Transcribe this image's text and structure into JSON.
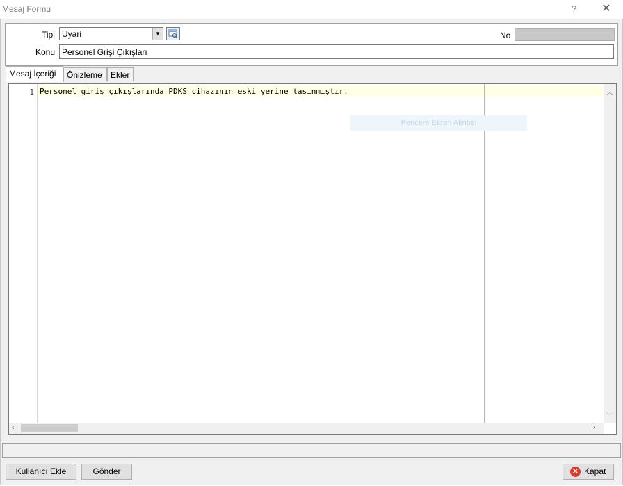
{
  "window": {
    "title": "Mesaj Formu",
    "help_glyph": "?",
    "close_glyph": "✕"
  },
  "form": {
    "type_label": "Tipi",
    "type_value": "Uyari",
    "no_label": "No",
    "no_value": "",
    "subject_label": "Konu",
    "subject_value": "Personel Grişi Çıkışları"
  },
  "tabs": [
    {
      "label": "Mesaj İçeriği",
      "active": true
    },
    {
      "label": "Önizleme",
      "active": false
    },
    {
      "label": "Ekler",
      "active": false
    }
  ],
  "editor": {
    "line_numbers": [
      "1"
    ],
    "lines": [
      "Personel giriş çıkışlarında PDKS cihazının eski yerine taşınmıştır."
    ],
    "overlay_text": "Pencere Ekran Alıntısı"
  },
  "status": {
    "text": ""
  },
  "buttons": {
    "add_user": "Kullanıcı Ekle",
    "send": "Gönder",
    "close": "Kapat"
  },
  "colors": {
    "current_line": "#ffffe6",
    "close_icon": "#d93c2f"
  }
}
